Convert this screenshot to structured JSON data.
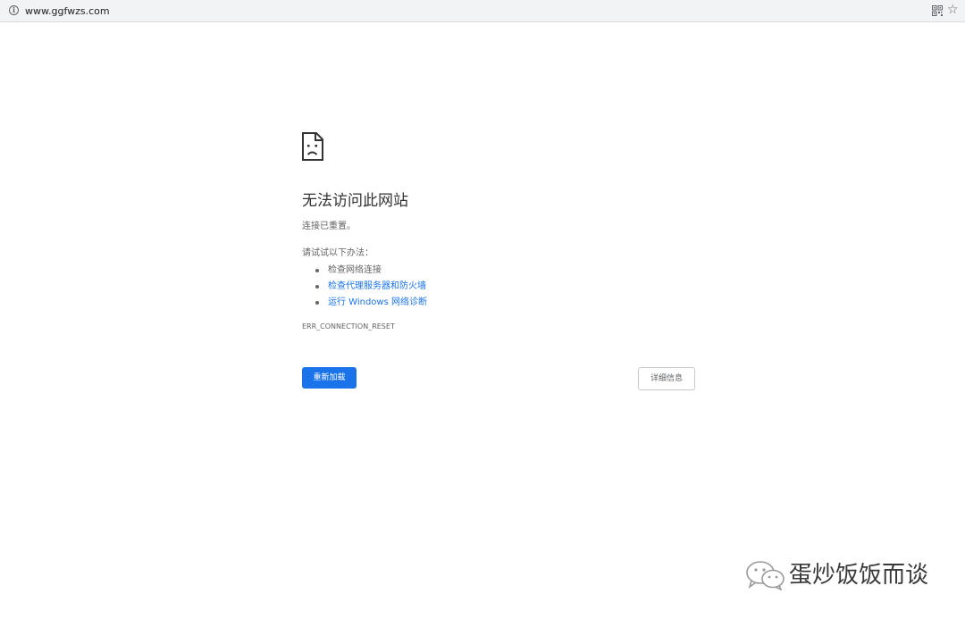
{
  "address_bar": {
    "url": "www.ggfwzs.com",
    "info_icon": "info-icon",
    "info_glyph": "i",
    "qr_icon": "qr-code-icon",
    "bookmark_icon": "star-icon",
    "star_glyph": "☆"
  },
  "error_page": {
    "icon": "sad-page-icon",
    "title": "无法访问此网站",
    "summary": "连接已重置。",
    "try_label": "请试试以下办法：",
    "suggestions": [
      {
        "text": "检查网络连接",
        "is_link": false
      },
      {
        "text": "检查代理服务器和防火墙",
        "is_link": true
      },
      {
        "text": "运行 Windows 网络诊断",
        "is_link": true
      }
    ],
    "error_code": "ERR_CONNECTION_RESET",
    "reload_button": "重新加载",
    "details_button": "详细信息"
  },
  "watermark": {
    "logo_icon": "wechat-icon",
    "text": "蛋炒饭饭而谈"
  },
  "colors": {
    "accent": "#1a73e8",
    "link": "#1a73e8",
    "text": "#646464",
    "heading": "#333333",
    "toolbar_bg": "#f1f3f4"
  }
}
